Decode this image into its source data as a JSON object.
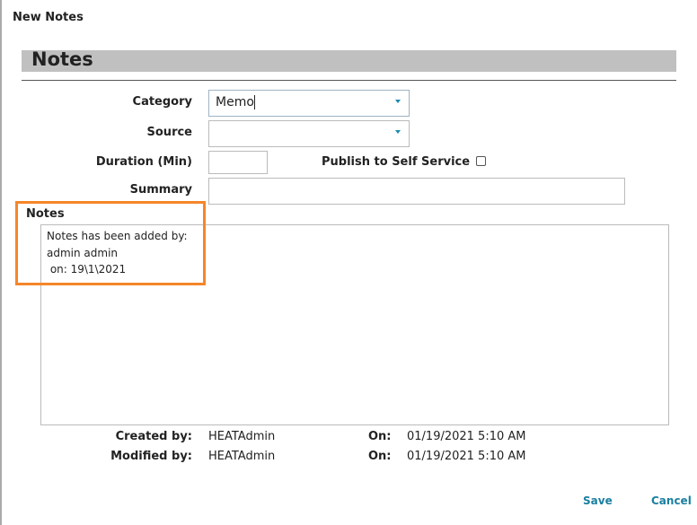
{
  "window": {
    "title": "New Notes"
  },
  "section": {
    "title": "Notes"
  },
  "form": {
    "category": {
      "label": "Category",
      "value": "Memo"
    },
    "source": {
      "label": "Source",
      "value": ""
    },
    "duration": {
      "label": "Duration (Min)",
      "value": ""
    },
    "publish": {
      "label": "Publish to Self Service",
      "checked": false
    },
    "summary": {
      "label": "Summary",
      "value": ""
    },
    "notes": {
      "label": "Notes",
      "value": "Notes has been added by:\nadmin admin\n on: 19\\1\\2021"
    }
  },
  "meta": {
    "created_label": "Created by:",
    "created_by": "HEATAdmin",
    "created_on_label": "On:",
    "created_on": "01/19/2021 5:10 AM",
    "modified_label": "Modified by:",
    "modified_by": "HEATAdmin",
    "modified_on_label": "On:",
    "modified_on": "01/19/2021 5:10 AM"
  },
  "actions": {
    "save": "Save",
    "cancel": "Cancel"
  },
  "colors": {
    "highlight": "#f5862a",
    "link": "#1a7fa0",
    "header_bar": "#c0c0c0"
  }
}
